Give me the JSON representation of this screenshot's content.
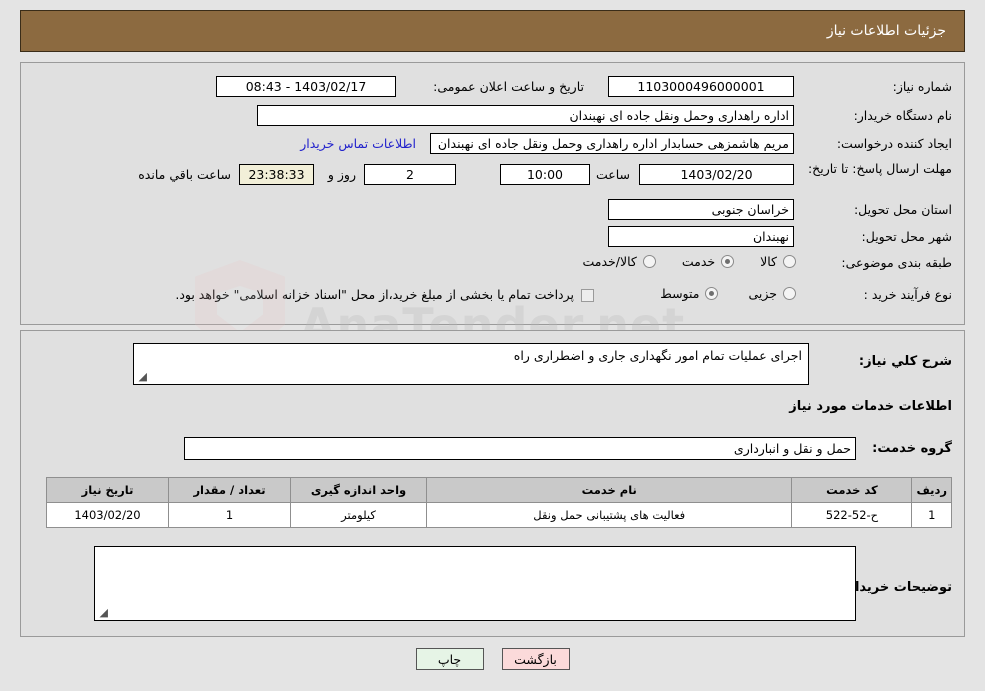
{
  "header": {
    "title": "جزئیات اطلاعات نیاز"
  },
  "form": {
    "need_number_label": "شماره نیاز:",
    "need_number_value": "1103000496000001",
    "announce_label": "تاریخ و ساعت اعلان عمومی:",
    "announce_value": "1403/02/17 - 08:43",
    "buyer_org_label": "نام دستگاه خریدار:",
    "buyer_org_value": "اداره راهداری وحمل ونقل جاده ای نهبندان",
    "creator_label": "ایجاد کننده درخواست:",
    "creator_value": "مریم هاشمزهی حسابدار اداره راهداری وحمل ونقل جاده ای نهبندان",
    "contact_link": "اطلاعات تماس خریدار",
    "deadline_label": "مهلت ارسال پاسخ: تا تاریخ:",
    "deadline_date": "1403/02/20",
    "time_label": "ساعت",
    "deadline_time": "10:00",
    "days_value": "2",
    "days_label": "روز و",
    "countdown_value": "23:38:33",
    "remaining_label": "ساعت باقي مانده",
    "province_label": "استان محل تحویل:",
    "province_value": "خراسان جنوبی",
    "city_label": "شهر محل تحویل:",
    "city_value": "نهبندان",
    "category_label": "طبقه بندی موضوعی:",
    "category_options": [
      {
        "label": "کالا",
        "selected": false
      },
      {
        "label": "خدمت",
        "selected": true
      },
      {
        "label": "کالا/خدمت",
        "selected": false
      }
    ],
    "process_label": "نوع فرآیند خرید :",
    "process_options": [
      {
        "label": "جزیی",
        "selected": false
      },
      {
        "label": "متوسط",
        "selected": true
      }
    ],
    "payment_note": "پرداخت تمام یا بخشی از مبلغ خرید،از محل \"اسناد خزانه اسلامی\" خواهد بود."
  },
  "description": {
    "label": "شرح کلي نیاز:",
    "value": "اجرای عملیات تمام امور نگهداری جاری و اضطراری راه"
  },
  "services_section": {
    "heading": "اطلاعات خدمات مورد نیاز",
    "group_label": "گروه خدمت:",
    "group_value": "حمل و نقل و انبارداری"
  },
  "table": {
    "columns": [
      "ردیف",
      "کد خدمت",
      "نام خدمت",
      "واحد اندازه گیری",
      "تعداد / مقدار",
      "تاریخ نیاز"
    ],
    "rows": [
      {
        "row": "1",
        "code": "ح-52-522",
        "name": "فعالیت های پشتیبانی حمل ونقل",
        "unit": "کیلومتر",
        "qty": "1",
        "date": "1403/02/20"
      }
    ]
  },
  "buyer_notes": {
    "label": "توضیحات خریدار:",
    "value": ""
  },
  "buttons": {
    "print": "چاپ",
    "back": "بازگشت"
  },
  "watermark": {
    "text": "AnaTender.net"
  },
  "colors": {
    "header_bg": "#8c6a40",
    "panel_bg": "#e0e0e0",
    "link": "#2222cc",
    "print_btn": "#e6f4e6",
    "back_btn": "#fbdada"
  }
}
